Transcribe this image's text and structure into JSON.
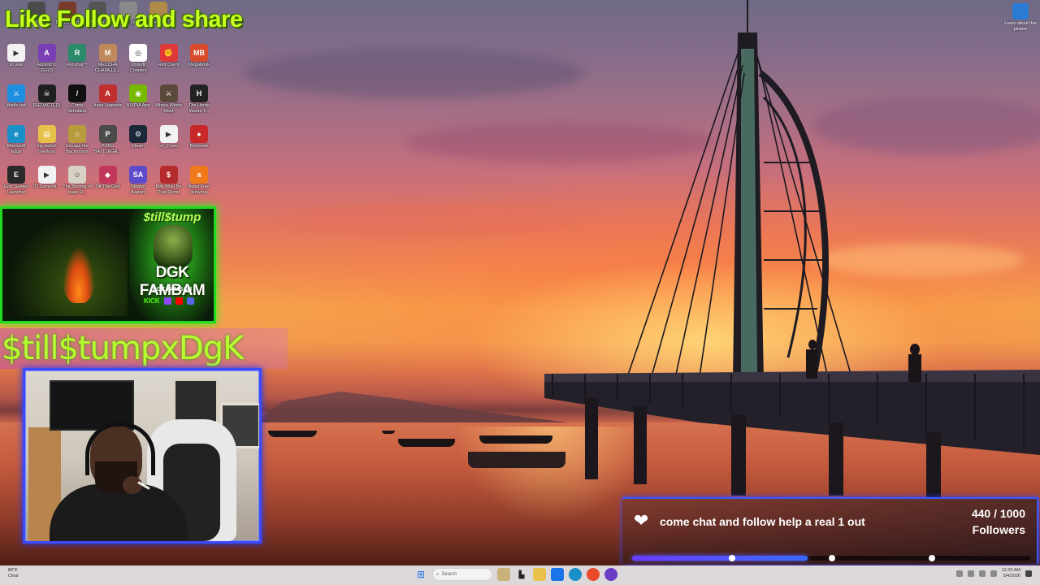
{
  "desktop_icons": [
    {
      "label": "vo.wav",
      "glyph": "▶",
      "color": "#f2f2f2"
    },
    {
      "label": "Ascend to ZERO",
      "glyph": "A",
      "color": "#7b3fb5"
    },
    {
      "label": "Retumal™",
      "glyph": "R",
      "color": "#2a8a6a"
    },
    {
      "label": "MECCHA CHAMELE...",
      "glyph": "M",
      "color": "#c08a5c"
    },
    {
      "label": "Ubisoft Connect",
      "glyph": "◎",
      "color": "#ffffff"
    },
    {
      "label": "Riot Client",
      "glyph": "✊",
      "color": "#e0383a"
    },
    {
      "label": "Megabonk",
      "glyph": "MB",
      "color": "#d94b2a"
    },
    {
      "label": "Battle.net",
      "glyph": "⚔",
      "color": "#1d8fe0"
    },
    {
      "label": "[REDACTED]",
      "glyph": "☠",
      "color": "#202020"
    },
    {
      "label": "Crime Simulator",
      "glyph": "/",
      "color": "#101010"
    },
    {
      "label": "Apex Legends",
      "glyph": "A",
      "color": "#c0302e"
    },
    {
      "label": "NVIDIA App",
      "glyph": "◉",
      "color": "#76b900"
    },
    {
      "label": "Where Winds Meet",
      "glyph": "⚔",
      "color": "#5a4a3a"
    },
    {
      "label": "The Horde Wants Y...",
      "glyph": "H",
      "color": "#222222"
    },
    {
      "label": "Microsoft Edge",
      "glyph": "e",
      "color": "#1b8fc7"
    },
    {
      "label": "my switch overlays",
      "glyph": "▤",
      "color": "#e7c24b"
    },
    {
      "label": "Escape the Backrooms",
      "glyph": "⌂",
      "color": "#b79b3c"
    },
    {
      "label": "PUBG BATTLEGR...",
      "glyph": "P",
      "color": "#4b4b4b"
    },
    {
      "label": "Steam",
      "glyph": "⚙",
      "color": "#1b2838"
    },
    {
      "label": "vo_2.wav",
      "glyph": "▶",
      "color": "#f2f2f2"
    },
    {
      "label": "Bodycam",
      "glyph": "●",
      "color": "#c72828"
    },
    {
      "label": "Epic Games Launcher",
      "glyph": "E",
      "color": "#2a2a2a"
    },
    {
      "label": "07 Somethi...",
      "glyph": "▶",
      "color": "#f2f2f2"
    },
    {
      "label": "The Binding of Isaac R...",
      "glyph": "☺",
      "color": "#d8d2c4"
    },
    {
      "label": "Off The Grid",
      "glyph": "◆",
      "color": "#c2385a"
    },
    {
      "label": "Stream Avatars",
      "glyph": "SA",
      "color": "#5d4bcc"
    },
    {
      "label": "Bills Must Be Paid Demo",
      "glyph": "$",
      "color": "#b52b2b"
    },
    {
      "label": "Avast Free Antivirus",
      "glyph": "a",
      "color": "#f07a1a"
    },
    {
      "label": "",
      "glyph": "",
      "color": "#4b4b4b"
    },
    {
      "label": "The Binding",
      "glyph": "",
      "color": "#7a3a2a"
    },
    {
      "label": "Waves",
      "glyph": "",
      "color": "#555555"
    },
    {
      "label": "Master Duel",
      "glyph": "",
      "color": "#8a8a8a"
    },
    {
      "label": "Zomboid",
      "glyph": "",
      "color": "#b08a4a"
    }
  ],
  "learn_picture": "Learn about this picture",
  "banner_text": "Like Follow and share",
  "promo": {
    "top_text": "$till$tump",
    "title": "DGK FAMBAM",
    "subtitle": "DGK FAMBAM",
    "social_kick": "KICK"
  },
  "gamer_tag": "$till$tumpxDgK",
  "goal": {
    "message": "come chat and follow help a real 1 out",
    "current": 440,
    "target": 1000,
    "count_text": "440 / 1000",
    "unit": "Followers",
    "fill_fraction": 0.44
  },
  "taskbar": {
    "weather_temp": "82°F",
    "weather_cond": "Clear",
    "search_placeholder": "Search",
    "time": "12:20 AM",
    "date": "5/4/2026"
  },
  "colors": {
    "banner": "#c9ff1c",
    "promo_border": "#1fdc1f",
    "webcam_border": "#3a4bff",
    "goal_accent": "#3c58ff"
  }
}
